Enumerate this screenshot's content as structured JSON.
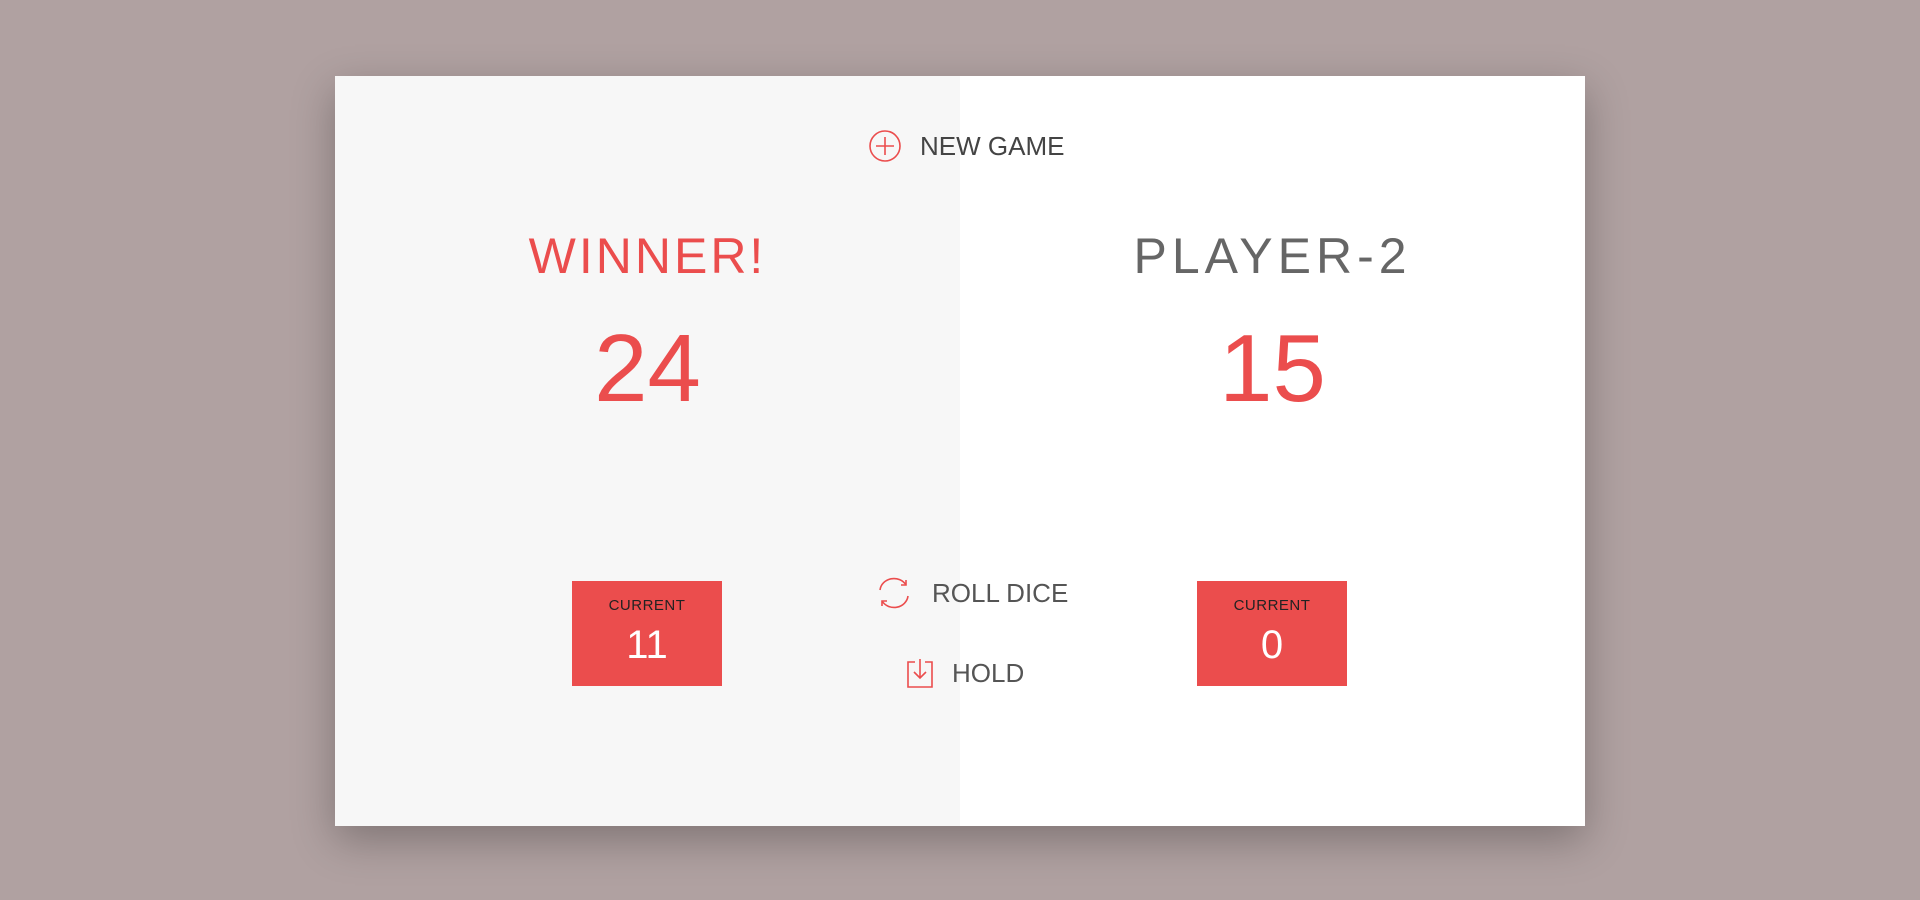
{
  "buttons": {
    "new_game": "NEW GAME",
    "roll_dice": "ROLL DICE",
    "hold": "HOLD"
  },
  "icons": {
    "new_game": "plus-circle-icon",
    "roll_dice": "refresh-icon",
    "hold": "download-icon"
  },
  "players": [
    {
      "name": "WINNER!",
      "score": "24",
      "current_label": "CURRENT",
      "current_score": "11",
      "state": "winner"
    },
    {
      "name": "PLAYER-2",
      "score": "15",
      "current_label": "CURRENT",
      "current_score": "0",
      "state": "normal"
    }
  ],
  "colors": {
    "accent": "#eb4d4d",
    "background": "#b0a1a1",
    "panel_inactive": "#f7f7f7",
    "panel_active": "#ffffff"
  }
}
